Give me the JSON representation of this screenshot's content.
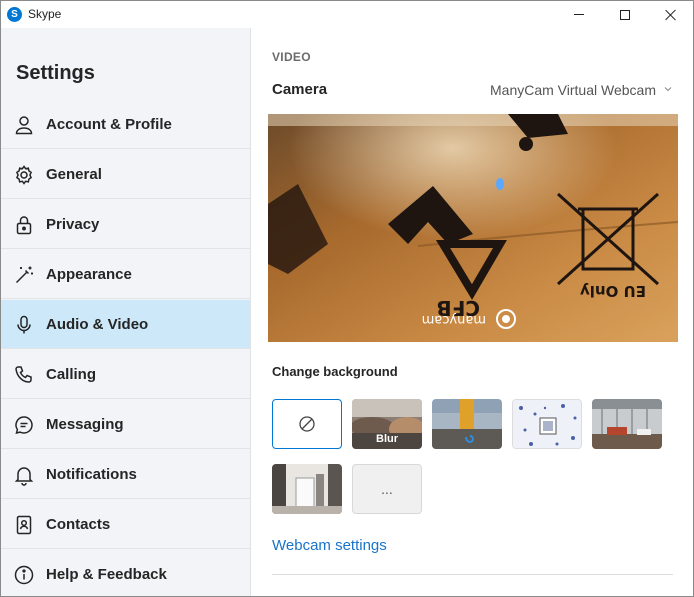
{
  "window": {
    "app_name": "Skype",
    "app_logo_letter": "S",
    "minimize_icon": "minimize-icon",
    "maximize_icon": "maximize-icon",
    "close_icon": "close-icon"
  },
  "sidebar": {
    "title": "Settings",
    "items": [
      {
        "label": "Account & Profile",
        "icon": "person-icon",
        "active": false
      },
      {
        "label": "General",
        "icon": "gear-icon",
        "active": false
      },
      {
        "label": "Privacy",
        "icon": "lock-icon",
        "active": false
      },
      {
        "label": "Appearance",
        "icon": "magic-wand-icon",
        "active": false
      },
      {
        "label": "Audio & Video",
        "icon": "microphone-icon",
        "active": true
      },
      {
        "label": "Calling",
        "icon": "phone-icon",
        "active": false
      },
      {
        "label": "Messaging",
        "icon": "chat-bubble-icon",
        "active": false
      },
      {
        "label": "Notifications",
        "icon": "bell-icon",
        "active": false
      },
      {
        "label": "Contacts",
        "icon": "contact-card-icon",
        "active": false
      },
      {
        "label": "Help & Feedback",
        "icon": "info-icon",
        "active": false
      }
    ]
  },
  "main": {
    "section_label": "VIDEO",
    "camera_label": "Camera",
    "camera_selected": "ManyCam Virtual Webcam",
    "preview": {
      "box_text_recycle": "CFB",
      "box_text_eu": "EU Only",
      "watermark": "manycam"
    },
    "background": {
      "title": "Change background",
      "tiles": [
        {
          "type": "none",
          "icon": "no-background-icon"
        },
        {
          "type": "blur",
          "label": "Blur"
        },
        {
          "type": "image",
          "name": "bing-landscape"
        },
        {
          "type": "image",
          "name": "snowflake-pattern"
        },
        {
          "type": "image",
          "name": "office-interior"
        },
        {
          "type": "image",
          "name": "hallway-room"
        },
        {
          "type": "more",
          "label": "..."
        }
      ]
    },
    "webcam_settings_link": "Webcam settings"
  },
  "colors": {
    "accent": "#0078d4",
    "sidebar_bg": "#f2f4f7",
    "active_item_bg": "#cde9f9",
    "link": "#1a73c8",
    "cardboard": "#a9682a"
  }
}
